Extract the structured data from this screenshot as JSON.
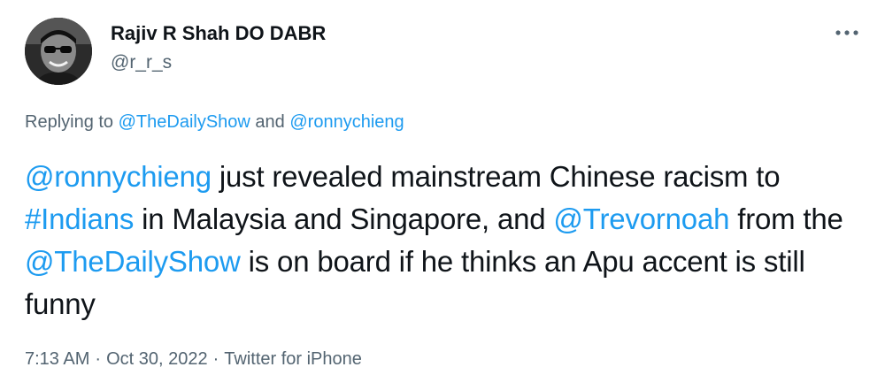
{
  "author": {
    "display_name": "Rajiv R Shah DO DABR",
    "handle": "@r_r_s"
  },
  "more_icon": "more-horizontal-icon",
  "reply_context": {
    "prefix": "Replying to ",
    "mention_1": "@TheDailyShow",
    "connector": " and ",
    "mention_2": "@ronnychieng"
  },
  "tweet": {
    "parts": {
      "p0": "@ronnychieng",
      "p1": " just revealed mainstream Chinese racism to ",
      "p2": "#Indians",
      "p3": " in Malaysia and Singapore, and ",
      "p4": "@Trevornoah",
      "p5": " from the ",
      "p6": "@TheDailyShow",
      "p7": " is on board if he thinks an Apu accent is still funny"
    }
  },
  "meta": {
    "time": "7:13 AM",
    "separator": "·",
    "date": "Oct 30, 2022",
    "source": "Twitter for iPhone"
  },
  "colors": {
    "link": "#1d9bf0",
    "secondary_text": "#536471",
    "primary_text": "#0f1419"
  }
}
